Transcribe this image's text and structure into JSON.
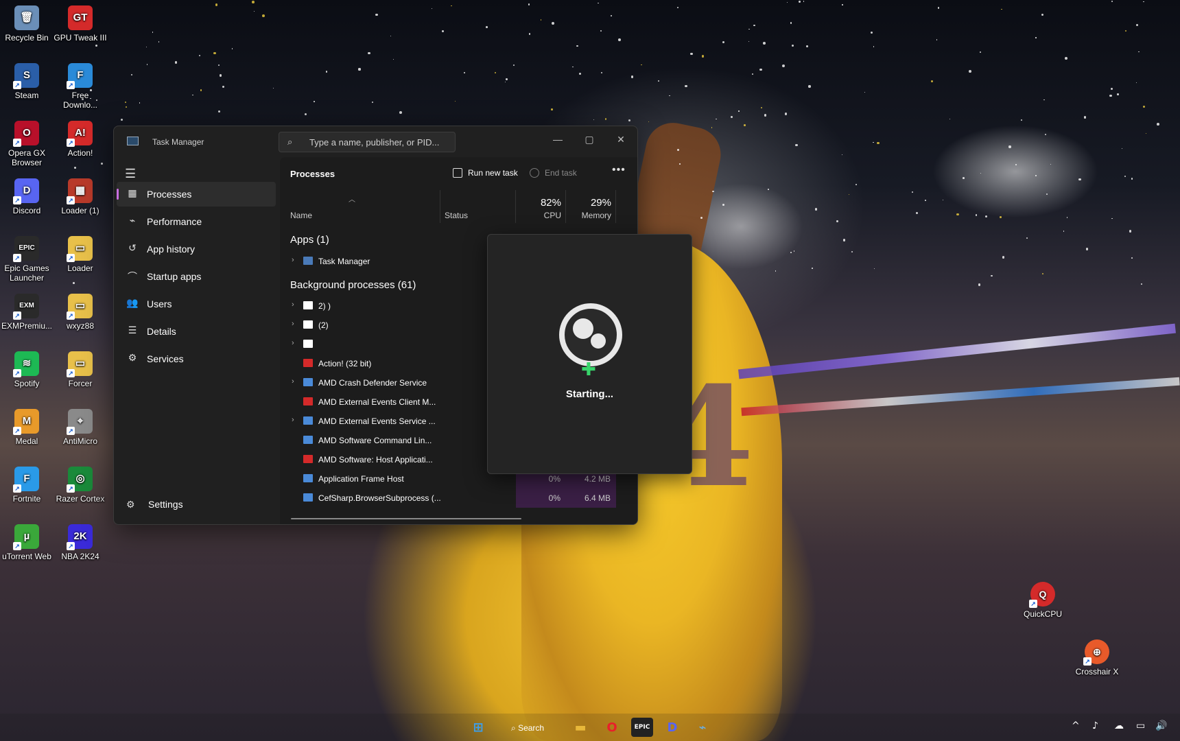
{
  "desktop": {
    "icons_left": [
      {
        "label": "Recycle Bin",
        "glyph": "🗑",
        "color": "#6b8fb8",
        "icon": "recycle-bin-icon"
      },
      {
        "label": "GPU Tweak III",
        "glyph": "GT",
        "color": "#d42a2a",
        "icon": "gpu-tweak-icon"
      },
      {
        "label": "Steam",
        "glyph": "S",
        "color": "#2a5ea8",
        "icon": "steam-icon"
      },
      {
        "label": "Free Downlo...",
        "glyph": "F",
        "color": "#2a8ad8",
        "icon": "free-download-icon"
      },
      {
        "label": "Opera GX Browser",
        "glyph": "O",
        "color": "#b8102a",
        "icon": "opera-gx-icon"
      },
      {
        "label": "Action!",
        "glyph": "A!",
        "color": "#d42a2a",
        "icon": "action-icon"
      },
      {
        "label": "Discord",
        "glyph": "D",
        "color": "#5865f2",
        "icon": "discord-icon"
      },
      {
        "label": "Loader (1)",
        "glyph": "▦",
        "color": "#b83a2a",
        "icon": "loader-archive-icon"
      },
      {
        "label": "Epic Games Launcher",
        "glyph": "EPIC",
        "color": "#2a2a2a",
        "icon": "epic-games-icon"
      },
      {
        "label": "Loader",
        "glyph": "▭",
        "color": "#e8c04a",
        "icon": "loader-folder-icon"
      },
      {
        "label": "EXMPremiu...",
        "glyph": "EXM",
        "color": "#2a2a2a",
        "icon": "exm-icon"
      },
      {
        "label": "wxyz88",
        "glyph": "▭",
        "color": "#e8c04a",
        "icon": "folder-icon"
      },
      {
        "label": "Spotify",
        "glyph": "≋",
        "color": "#1db954",
        "icon": "spotify-icon"
      },
      {
        "label": "Forcer",
        "glyph": "▭",
        "color": "#e8c04a",
        "icon": "forcer-folder-icon"
      },
      {
        "label": "Medal",
        "glyph": "M",
        "color": "#e89a2a",
        "icon": "medal-icon"
      },
      {
        "label": "AntiMicro",
        "glyph": "⌖",
        "color": "#8a8a8a",
        "icon": "antimicro-icon"
      },
      {
        "label": "Fortnite",
        "glyph": "F",
        "color": "#2a9ae8",
        "icon": "fortnite-icon"
      },
      {
        "label": "Razer Cortex",
        "glyph": "◎",
        "color": "#1a8a3a",
        "icon": "razer-cortex-icon"
      },
      {
        "label": "uTorrent Web",
        "glyph": "µ",
        "color": "#3aa83a",
        "icon": "utorrent-icon"
      },
      {
        "label": "NBA 2K24",
        "glyph": "2K",
        "color": "#3a2ad8",
        "icon": "nba2k-icon"
      }
    ],
    "icons_right": [
      {
        "label": "QuickCPU",
        "glyph": "Q",
        "color": "#d42a2a",
        "icon": "quickcpu-icon"
      },
      {
        "label": "Crosshair X",
        "glyph": "⊕",
        "color": "#e85a2a",
        "icon": "crosshair-x-icon"
      }
    ]
  },
  "task_manager": {
    "title": "Task Manager",
    "search_placeholder": "Type a name, publisher, or PID...",
    "nav": [
      {
        "label": "Processes",
        "glyph": "▦",
        "icon": "processes-icon",
        "active": true
      },
      {
        "label": "Performance",
        "glyph": "⌁",
        "icon": "performance-icon",
        "active": false
      },
      {
        "label": "App history",
        "glyph": "↺",
        "icon": "app-history-icon",
        "active": false
      },
      {
        "label": "Startup apps",
        "glyph": "⌒",
        "icon": "startup-apps-icon",
        "active": false
      },
      {
        "label": "Users",
        "glyph": "👥",
        "icon": "users-icon",
        "active": false
      },
      {
        "label": "Details",
        "glyph": "☰",
        "icon": "details-icon",
        "active": false
      },
      {
        "label": "Services",
        "glyph": "⚙",
        "icon": "services-icon",
        "active": false
      }
    ],
    "settings_label": "Settings",
    "page_title": "Processes",
    "run_new_task": "Run new task",
    "end_task": "End task",
    "columns": {
      "name": "Name",
      "status": "Status",
      "cpu_pct": "82%",
      "cpu": "CPU",
      "mem_pct": "29%",
      "memory": "Memory"
    },
    "apps_title": "Apps (1)",
    "apps": [
      {
        "name": "Task Manager",
        "expandable": true,
        "icon_color": "#4a7ab8"
      }
    ],
    "bg_title": "Background processes (61)",
    "background": [
      {
        "name": "2)   )",
        "expandable": true,
        "icon_color": "#ffffff"
      },
      {
        "name": "       (2)",
        "expandable": true,
        "icon_color": "#ffffff"
      },
      {
        "name": "",
        "expandable": true,
        "icon_color": "#ffffff"
      },
      {
        "name": "Action! (32 bit)",
        "expandable": false,
        "icon_color": "#d42a2a"
      },
      {
        "name": "AMD Crash Defender Service",
        "expandable": true,
        "icon_color": "#4a8ad8"
      },
      {
        "name": "AMD External Events Client M...",
        "expandable": false,
        "icon_color": "#d42a2a"
      },
      {
        "name": "AMD External Events Service ...",
        "expandable": true,
        "icon_color": "#4a8ad8"
      },
      {
        "name": "AMD Software Command Lin...",
        "expandable": false,
        "icon_color": "#4a8ad8"
      },
      {
        "name": "AMD Software: Host Applicati...",
        "expandable": false,
        "icon_color": "#d42a2a"
      },
      {
        "name": "Application Frame Host",
        "expandable": false,
        "icon_color": "#4a8ad8",
        "cpu": "0%",
        "mem": "4.2 MB"
      },
      {
        "name": "CefSharp.BrowserSubprocess (...",
        "expandable": false,
        "icon_color": "#4a8ad8",
        "cpu": "0%",
        "mem": "6.4 MB"
      }
    ]
  },
  "splash": {
    "status": "Starting..."
  },
  "taskbar": {
    "search_label": "Search",
    "items": [
      {
        "glyph": "⊞",
        "color": "#3aa0f0",
        "icon": "start-icon"
      },
      {
        "glyph": "▬",
        "color": "#e8b83a",
        "icon": "file-explorer-icon"
      },
      {
        "glyph": "O",
        "color": "#e8202a",
        "icon": "opera-gx-taskbar-icon"
      },
      {
        "glyph": "EPIC",
        "color": "#ffffff",
        "icon": "epic-games-taskbar-icon"
      },
      {
        "glyph": "D",
        "color": "#5865f2",
        "icon": "discord-taskbar-icon"
      },
      {
        "glyph": "⌁",
        "color": "#6ab0e8",
        "icon": "task-manager-taskbar-icon"
      }
    ],
    "tray": [
      {
        "glyph": "^",
        "icon": "tray-overflow-icon"
      },
      {
        "glyph": "♪",
        "icon": "tray-audio-icon"
      },
      {
        "glyph": "☁",
        "icon": "tray-onedrive-icon"
      },
      {
        "glyph": "▭",
        "icon": "tray-network-icon"
      },
      {
        "glyph": "🔊",
        "icon": "tray-volume-icon"
      }
    ]
  }
}
